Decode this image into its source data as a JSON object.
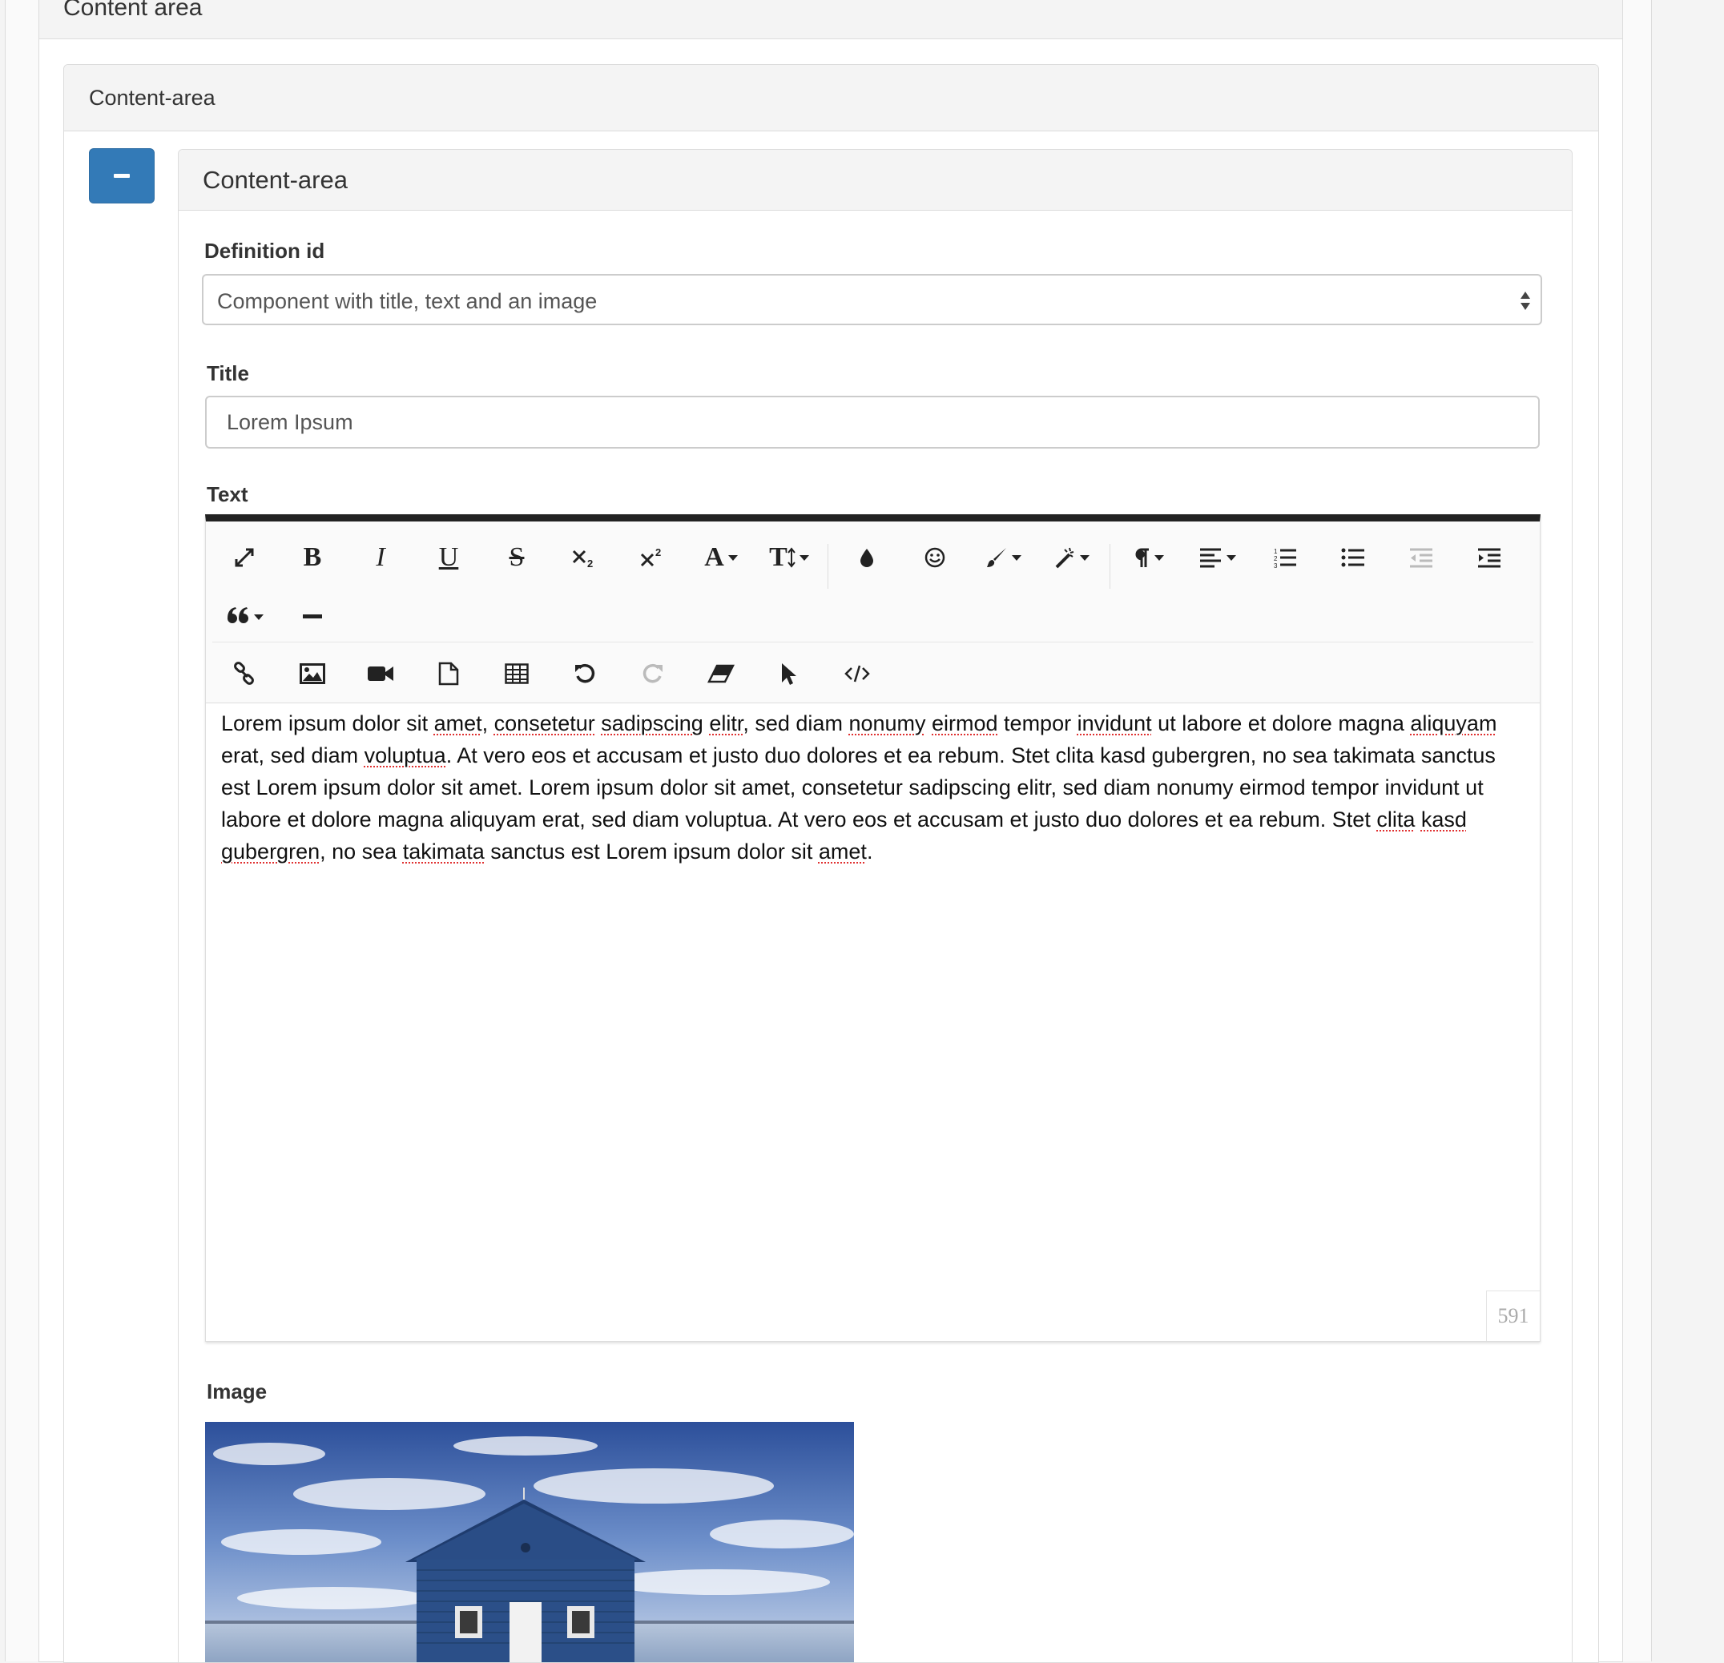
{
  "outer_panel": {
    "title": "Content area"
  },
  "mid_panel": {
    "title": "Content-area"
  },
  "collapse_button": {
    "label": "−"
  },
  "inner_panel": {
    "title": "Content-area",
    "definition_label": "Definition id",
    "definition_value": "Component with title, text and an image",
    "title_label": "Title",
    "title_value": "Lorem Ipsum",
    "text_label": "Text",
    "image_label": "Image"
  },
  "editor": {
    "toolbar_row1": [
      "fullscreen-icon",
      "bold-icon",
      "italic-icon",
      "underline-icon",
      "strikethrough-icon",
      "subscript-icon",
      "superscript-icon",
      "font-family-icon",
      "font-size-icon",
      "color-icon",
      "emoticons-icon",
      "paint-brush-icon",
      "magic-wand-icon",
      "paragraph-icon",
      "align-icon",
      "ordered-list-icon",
      "unordered-list-icon",
      "outdent-icon",
      "indent-icon"
    ],
    "toolbar_row2": [
      "quote-icon",
      "horizontal-rule-icon"
    ],
    "toolbar_row3": [
      "link-icon",
      "image-icon",
      "video-icon",
      "file-icon",
      "table-icon",
      "undo-icon",
      "redo-icon",
      "eraser-icon",
      "select-all-icon",
      "html-icon"
    ],
    "labels": {
      "bold": "B",
      "italic": "I",
      "underline": "U",
      "strike": "S",
      "font": "A",
      "size": "T"
    },
    "content_segments": [
      {
        "t": "Lorem ipsum dolor sit ",
        "s": false
      },
      {
        "t": "amet",
        "s": true
      },
      {
        "t": ", ",
        "s": false
      },
      {
        "t": "consetetur",
        "s": true
      },
      {
        "t": " ",
        "s": false
      },
      {
        "t": "sadipscing",
        "s": true
      },
      {
        "t": " ",
        "s": false
      },
      {
        "t": "elitr",
        "s": true
      },
      {
        "t": ", sed diam ",
        "s": false
      },
      {
        "t": "nonumy",
        "s": true
      },
      {
        "t": " ",
        "s": false
      },
      {
        "t": "eirmod",
        "s": true
      },
      {
        "t": " tempor ",
        "s": false
      },
      {
        "t": "invidunt",
        "s": true
      },
      {
        "t": " ut labore et dolore magna ",
        "s": false
      },
      {
        "t": "aliquyam",
        "s": true
      },
      {
        "t": " erat, sed diam ",
        "s": false
      },
      {
        "t": "voluptua",
        "s": true
      },
      {
        "t": ". At vero eos et accusam et justo duo dolores et ea rebum. Stet clita kasd gubergren, no sea takimata sanctus est Lorem ipsum dolor sit amet. Lorem ipsum dolor sit amet, consetetur sadipscing elitr, sed diam nonumy eirmod tempor invidunt ut labore et dolore magna aliquyam erat, sed diam voluptua. At vero eos et accusam et justo duo dolores et ea rebum. Stet ",
        "s": false
      },
      {
        "t": "clita",
        "s": true
      },
      {
        "t": " ",
        "s": false
      },
      {
        "t": "kasd",
        "s": true
      },
      {
        "t": " ",
        "s": false
      },
      {
        "t": "gubergren",
        "s": true
      },
      {
        "t": ", no sea ",
        "s": false
      },
      {
        "t": "takimata",
        "s": true
      },
      {
        "t": " sanctus est Lorem ipsum dolor sit ",
        "s": false
      },
      {
        "t": "amet",
        "s": true
      },
      {
        "t": ".",
        "s": false
      }
    ],
    "char_count": "591"
  },
  "colors": {
    "primary": "#337ab7",
    "panel_heading": "#f4f4f4",
    "border": "#dcdcdc",
    "toolbar_top": "#222222"
  }
}
